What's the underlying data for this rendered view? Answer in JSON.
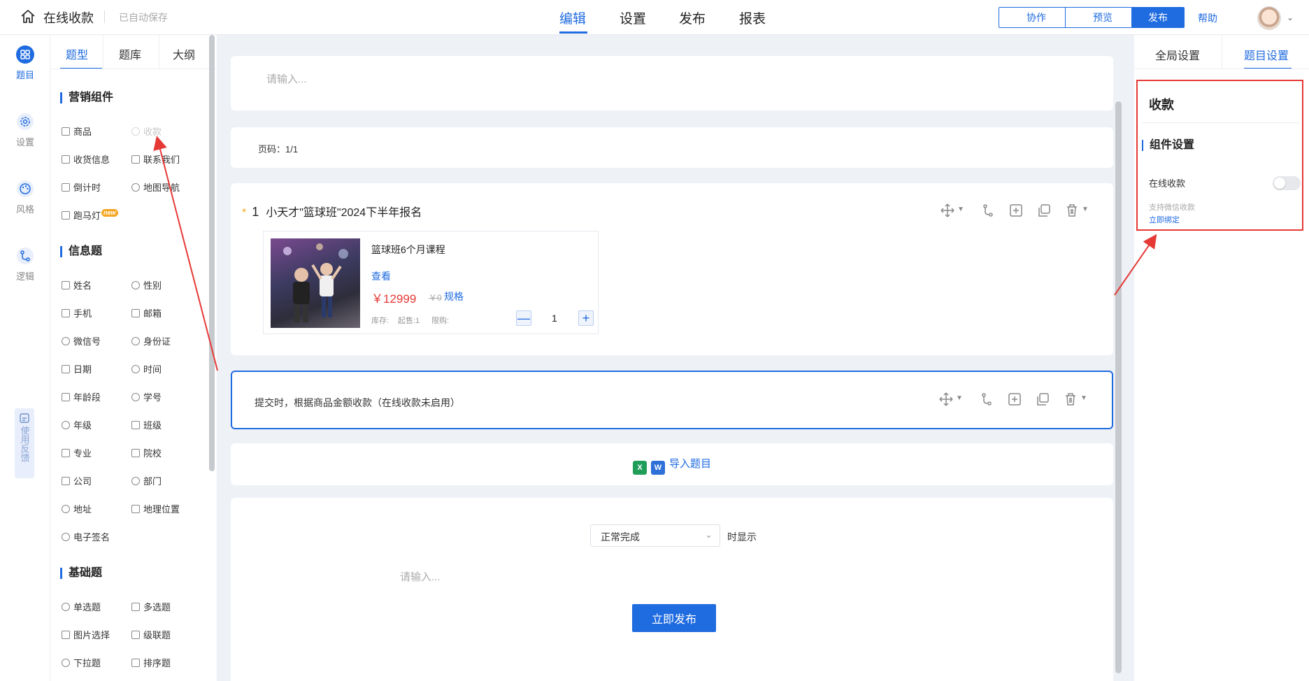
{
  "header": {
    "app_title": "在线收款",
    "autosave": "已自动保存",
    "tabs": [
      {
        "label": "编辑",
        "active": true
      },
      {
        "label": "设置",
        "active": false
      },
      {
        "label": "发布",
        "active": false
      },
      {
        "label": "报表",
        "active": false
      }
    ],
    "collab_label": "协作",
    "preview_label": "预览",
    "publish_label": "发布",
    "help_label": "帮助"
  },
  "rail": {
    "items": [
      {
        "label": "题目",
        "icon": "grid-icon",
        "active": true
      },
      {
        "label": "设置",
        "icon": "gear-icon",
        "active": false
      },
      {
        "label": "风格",
        "icon": "palette-icon",
        "active": false
      },
      {
        "label": "逻辑",
        "icon": "logic-icon",
        "active": false
      }
    ],
    "feedback_label": "使用反馈"
  },
  "panel": {
    "tabs": [
      "题型",
      "题库",
      "大纲"
    ],
    "sections": [
      {
        "title": "营销组件",
        "items": [
          "商品",
          "收款",
          "收货信息",
          "联系我们",
          "倒计时",
          "地图导航",
          "跑马灯"
        ],
        "new_badge": "new"
      },
      {
        "title": "信息题",
        "items": [
          "姓名",
          "性别",
          "手机",
          "邮箱",
          "微信号",
          "身份证",
          "日期",
          "时间",
          "年龄段",
          "学号",
          "年级",
          "班级",
          "专业",
          "院校",
          "公司",
          "部门",
          "地址",
          "地理位置",
          "电子签名"
        ]
      },
      {
        "title": "基础题",
        "items": [
          "单选题",
          "多选题",
          "图片选择",
          "级联题",
          "下拉题",
          "排序题"
        ]
      }
    ]
  },
  "canvas": {
    "header_placeholder": "请输入...",
    "page_indicator": "页码：1/1",
    "question": {
      "required_mark": "*",
      "number": "1",
      "title": "小天才\"篮球班\"2024下半年报名",
      "product": {
        "name": "篮球班6个月课程",
        "view_link": "查看",
        "price": "￥12999",
        "original_price": "￥0",
        "spec_link": "规格",
        "stock_label": "库存:",
        "min_label": "起售:1",
        "limit_label": "限购:",
        "quantity": "1",
        "minus": "—",
        "plus": "+"
      }
    },
    "payment_note": "提交时，根据商品金额收款（在线收款未启用）",
    "import_label": "导入题目",
    "ending": {
      "select_value": "正常完成",
      "select_suffix": "时显示",
      "placeholder": "请输入...",
      "publish_button": "立即发布"
    }
  },
  "right_panel": {
    "tabs": [
      {
        "label": "全局设置",
        "active": false
      },
      {
        "label": "题目设置",
        "active": true
      }
    ],
    "title": "收款",
    "section": "组件设置",
    "online_pay_label": "在线收款",
    "online_pay_enabled": false,
    "hint": "支持微信收款",
    "bind_link": "立即绑定"
  },
  "colors": {
    "accent": "#1f6be0",
    "highlight_red": "#e53935",
    "price_red": "#e53935",
    "required_orange": "#f5a623"
  }
}
